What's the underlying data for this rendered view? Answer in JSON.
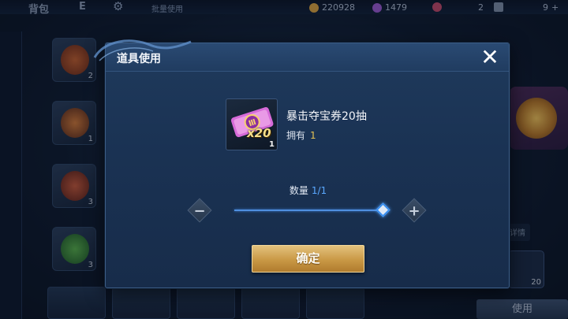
{
  "topbar": {
    "tab_bag": "背包",
    "tab_second": "E",
    "batch_label": "批量使用",
    "currency": [
      {
        "icon": "gold-coin-icon",
        "value": "220928",
        "color": "#d9a441"
      },
      {
        "icon": "gem-icon",
        "value": "1479",
        "color": "#9a5bd1"
      },
      {
        "icon": "voucher-icon",
        "value": "2",
        "color": "#c04a6a"
      },
      {
        "icon": "token-icon",
        "value": "9",
        "color": "#7d8ea6"
      }
    ]
  },
  "background": {
    "slot_counts": [
      "2",
      "1",
      "3",
      "3"
    ],
    "right_tabs": [
      "详情"
    ],
    "right_slot_count": "20",
    "use_button": "使用"
  },
  "dialog": {
    "title": "道具使用",
    "item": {
      "name": "暴击夺宝券20抽",
      "icon_text": "x20",
      "icon_count": "1",
      "owned_label": "拥有",
      "owned_value": "1"
    },
    "quantity": {
      "label": "数量",
      "value": "1/1",
      "fraction": 1.0
    },
    "confirm_label": "确定"
  }
}
